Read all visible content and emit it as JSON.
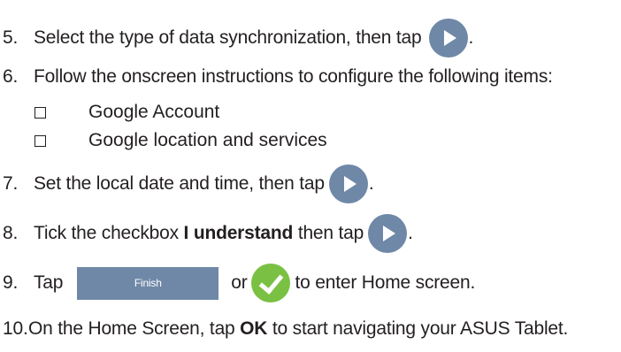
{
  "steps": [
    {
      "num": "5.",
      "text_before": "Select the type of data synchronization, then tap",
      "text_after": "."
    },
    {
      "num": "6.",
      "text": "Follow the onscreen instructions to configure the following items:"
    },
    {
      "num": "7.",
      "text_before": "Set the local date and time, then tap",
      "text_after": "."
    },
    {
      "num": "8.",
      "text_before": "Tick the checkbox",
      "bold": "I understand",
      "text_mid": "then tap",
      "text_after": "."
    },
    {
      "num": "9.",
      "text_before": "Tap",
      "text_mid": "or",
      "text_after": "to enter Home screen."
    },
    {
      "num": "10.",
      "text_before": "On the Home Screen, tap",
      "bold": "OK",
      "text_after": "to start navigating your ASUS Tablet."
    }
  ],
  "sub_items": [
    "Google Account",
    "Google location and services"
  ],
  "finish_label": "Finish",
  "icons": {
    "next": "next-arrow-icon",
    "check": "checkmark-icon",
    "checkbox": "checkbox-icon"
  },
  "colors": {
    "next_button": "#6f88a7",
    "finish_button": "#6f88a7",
    "check_button": "#7ac143",
    "text": "#231f20"
  }
}
